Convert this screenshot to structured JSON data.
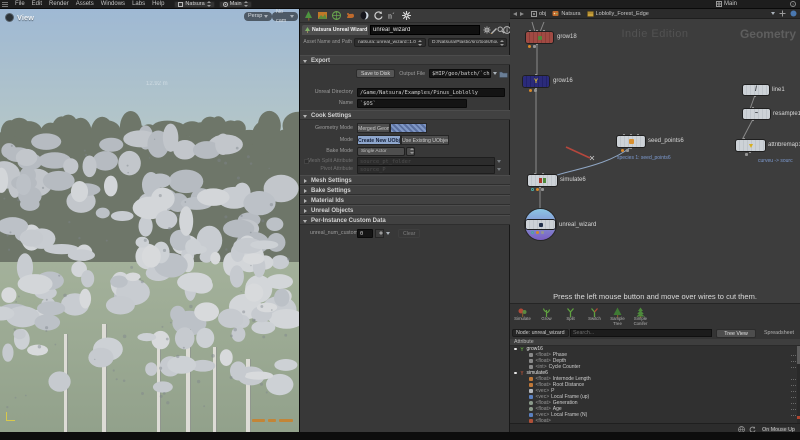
{
  "menu": {
    "items": [
      "File",
      "Edit",
      "Render",
      "Assets",
      "Windows",
      "Labs",
      "Help"
    ],
    "desktop": "Natsura",
    "scene": "Main"
  },
  "viewport": {
    "title": "View",
    "persp_button": "Persp",
    "cam_button": "No cam",
    "measure": "12.92 m"
  },
  "params": {
    "tab_title": "Natsura Unreal Wizard",
    "node_name": "unreal_wizard",
    "asset_label": "Asset Name and Path",
    "asset_name": "natsura::unreal_wizard::1.0",
    "asset_path": "D:/Natsura/Plastic/src/tools/houdini/houd...",
    "export_header": "Export",
    "save_to_disk": "Save to Disk",
    "output_file_label": "Output File",
    "output_file_value": "$HIP/geo/batch/`chs(\"nam",
    "unreal_directory_label": "Unreal Directory",
    "unreal_directory_value": "/Game/Natsura/Examples/Pinus_Loblolly",
    "name_label": "Name",
    "name_value": "`$OS`",
    "cook_header": "Cook Settings",
    "geometry_mode_label": "Geometry Mode",
    "geometry_mode_option1": "Merged Geometry",
    "geometry_mode_option2": "",
    "mode_label": "Mode",
    "mode_option1": "Create New UObjects",
    "mode_option2": "Use Existing UObjects",
    "bake_mode_label": "Bake Mode",
    "bake_mode_value": "Single Actor",
    "mesh_split_label": "Mesh Split Attribute",
    "mesh_split_value": "source_pt_folder",
    "pivot_label": "Pivot Attribute",
    "pivot_value": "source_P",
    "mesh_settings_header": "Mesh Settings",
    "bake_settings_header": "Bake Settings",
    "material_ids_header": "Material Ids",
    "unreal_objects_header": "Unreal Objects",
    "custom_data_header": "Per-Instance Custom Data",
    "custom_count_label": "unreal_num_custom_...",
    "custom_count_value": "0",
    "clear_button": "Clear"
  },
  "network": {
    "pane_title": "Main",
    "path_items": [
      "obj",
      "Natsura",
      "Loblolly_Forest_Edge"
    ],
    "watermark": "Indie Edition",
    "context_label": "Geometry",
    "nodes": [
      {
        "label": "grow18"
      },
      {
        "label": "grow16"
      },
      {
        "label": "seed_points6",
        "comment": "species 1: seed_points6"
      },
      {
        "label": "simulate6"
      },
      {
        "label": "unreal_wizard"
      },
      {
        "label": "line1"
      },
      {
        "label": "resample1"
      },
      {
        "label": "attribremap1",
        "comment": "curveu -> sourc"
      }
    ],
    "hint": "Press the left mouse button and move over wires to cut them."
  },
  "tools": {
    "items": [
      "Simulate",
      "Grow",
      "Split",
      "Switch",
      "Sample Tree",
      "Simple Conifer"
    ]
  },
  "inspector": {
    "node_label": "Node: unreal_wizard",
    "search_placeholder": "Search...",
    "tree_view_button": "Tree View",
    "spreadsheet_view_button": "Spreadsheet View",
    "column_header": "Attribute",
    "groups": [
      {
        "name": "grow16",
        "items": [
          {
            "type": "<float>",
            "label": "Phase"
          },
          {
            "type": "<float>",
            "label": "Depth"
          },
          {
            "type": "<int>",
            "label": "Cycle Counter"
          }
        ]
      },
      {
        "name": "simulate6",
        "items": [
          {
            "type": "<float>",
            "label": "Internode Length"
          },
          {
            "type": "<float>",
            "label": "Root Distance"
          },
          {
            "type": "<vec>",
            "label": "P"
          },
          {
            "type": "<vec>",
            "label": "Local Frame (up)"
          },
          {
            "type": "<float>",
            "label": "Generation"
          },
          {
            "type": "<float>",
            "label": "Age"
          },
          {
            "type": "<vec>",
            "label": "Local Frame (N)"
          },
          {
            "type": "<float>",
            "label": ""
          }
        ]
      }
    ],
    "update_mode": "On Mouse Up"
  }
}
